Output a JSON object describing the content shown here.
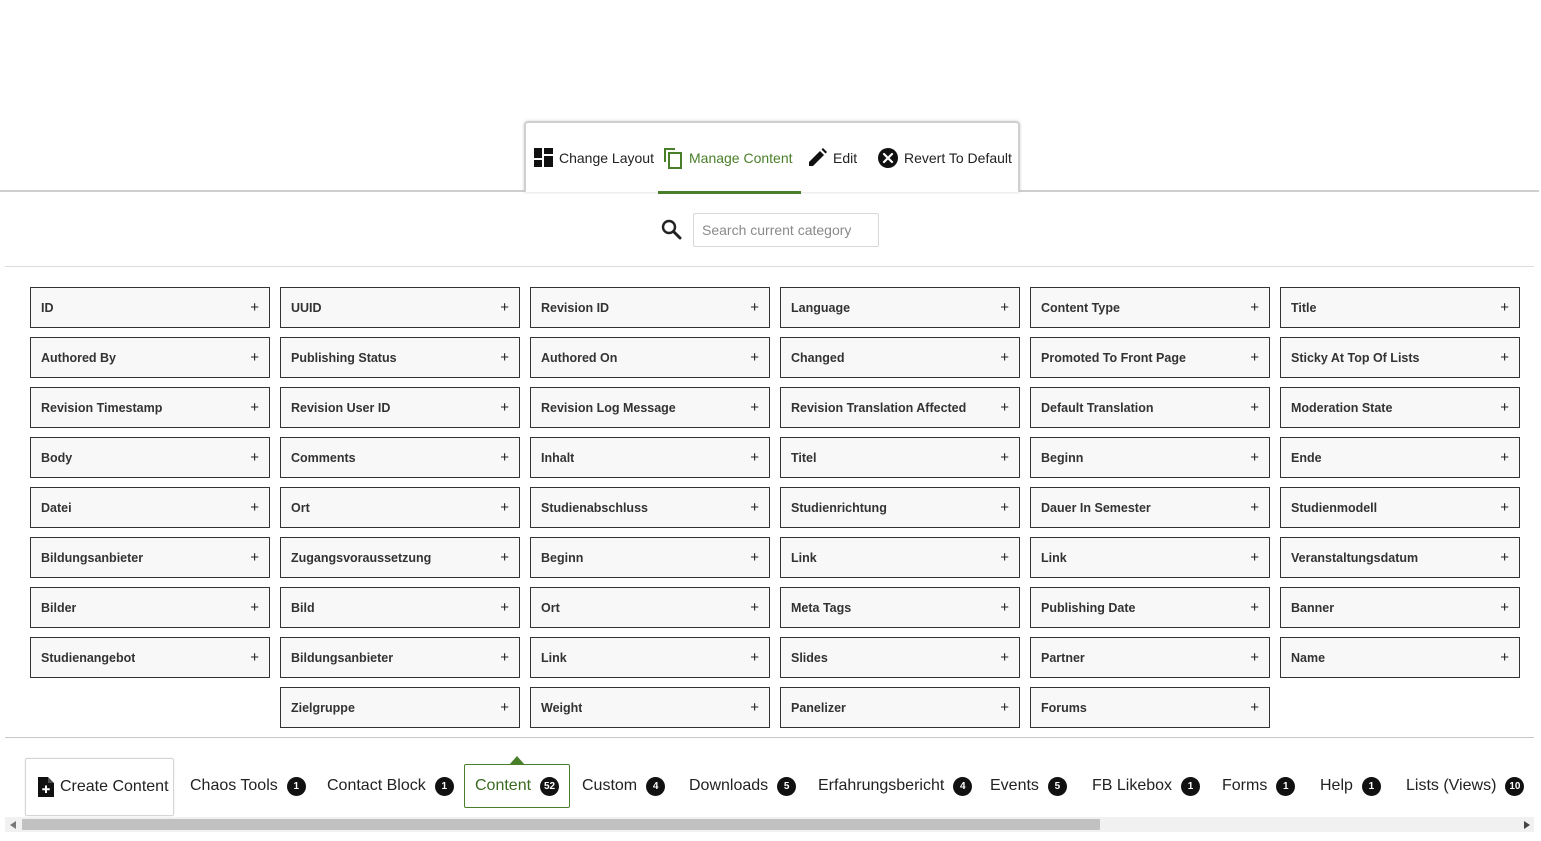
{
  "tabs": [
    {
      "label": "Change Layout",
      "icon": "layout-icon"
    },
    {
      "label": "Manage Content",
      "icon": "copy-icon",
      "active": true
    },
    {
      "label": "Edit",
      "icon": "pencil-icon"
    },
    {
      "label": "Revert To Default",
      "icon": "close-circle-icon"
    }
  ],
  "search": {
    "placeholder": "Search current category",
    "value": ""
  },
  "fields": [
    [
      "ID",
      "UUID",
      "Revision ID",
      "Language",
      "Content Type",
      "Title"
    ],
    [
      "Authored By",
      "Publishing Status",
      "Authored On",
      "Changed",
      "Promoted To Front Page",
      "Sticky At Top Of Lists"
    ],
    [
      "Revision Timestamp",
      "Revision User ID",
      "Revision Log Message",
      "Revision Translation Affected",
      "Default Translation",
      "Moderation State"
    ],
    [
      "Body",
      "Comments",
      "Inhalt",
      "Titel",
      "Beginn",
      "Ende"
    ],
    [
      "Datei",
      "Ort",
      "Studienabschluss",
      "Studienrichtung",
      "Dauer In Semester",
      "Studienmodell"
    ],
    [
      "Bildungsanbieter",
      "Zugangsvoraussetzung",
      "Beginn",
      "Link",
      "Link",
      "Veranstaltungsdatum"
    ],
    [
      "Bilder",
      "Bild",
      "Ort",
      "Meta Tags",
      "Publishing Date",
      "Banner"
    ],
    [
      "Studienangebot",
      "Bildungsanbieter",
      "Link",
      "Slides",
      "Partner",
      "Name"
    ],
    [
      "",
      "Zielgruppe",
      "Weight",
      "Panelizer",
      "Forums",
      ""
    ]
  ],
  "field_add_symbol": "+",
  "create_content": {
    "label": "Create Content"
  },
  "categories": [
    {
      "label": "Chaos Tools",
      "count": "1"
    },
    {
      "label": "Contact Block",
      "count": "1"
    },
    {
      "label": "Content",
      "count": "52",
      "active": true
    },
    {
      "label": "Custom",
      "count": "4"
    },
    {
      "label": "Downloads",
      "count": "5"
    },
    {
      "label": "Erfahrungsbericht",
      "count": "4"
    },
    {
      "label": "Events",
      "count": "5"
    },
    {
      "label": "FB Likebox",
      "count": "1"
    },
    {
      "label": "Forms",
      "count": "1"
    },
    {
      "label": "Help",
      "count": "1"
    },
    {
      "label": "Lists (Views)",
      "count": "10"
    }
  ],
  "colors": {
    "accent": "#4a7f2a",
    "badge": "#111111",
    "field_border": "#333333"
  }
}
